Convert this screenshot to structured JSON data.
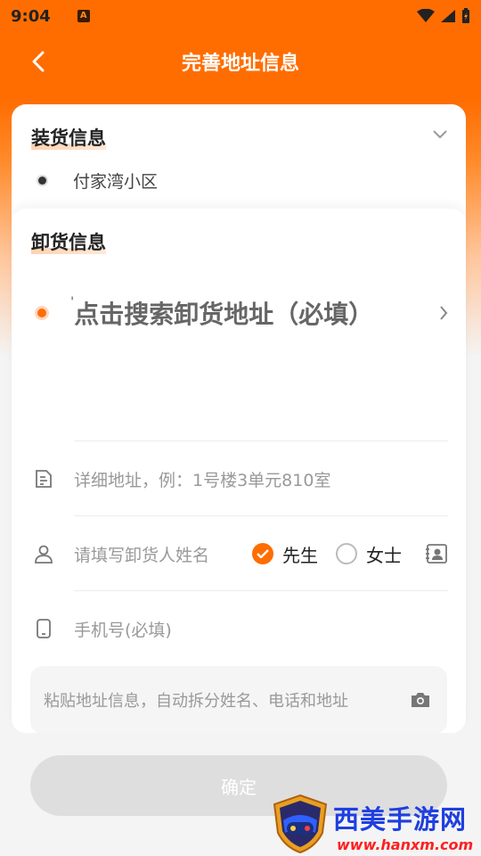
{
  "status_bar": {
    "time": "9:04",
    "app_icon_letter": "A"
  },
  "header": {
    "title": "完善地址信息"
  },
  "load_section": {
    "title": "装货信息",
    "address": "付家湾小区"
  },
  "unload_section": {
    "title": "卸货信息",
    "search_placeholder": "点击搜索卸货地址（必填）",
    "search_prefix": "'",
    "detail_placeholder": "详细地址，例：1号楼3单元810室",
    "name_placeholder": "请填写卸货人姓名",
    "gender_options": [
      {
        "label": "先生",
        "selected": true
      },
      {
        "label": "女士",
        "selected": false
      }
    ],
    "phone_placeholder": "手机号(必填)",
    "paste_placeholder": "粘贴地址信息，自动拆分姓名、电话和地址",
    "confirm_label": "确定"
  },
  "watermark": {
    "title": "西美手游网",
    "url": "www.hanxm.com"
  },
  "colors": {
    "accent": "#ff6d00",
    "button_disabled": "#dedede",
    "watermark_blue": "#1f3fe0",
    "watermark_red": "#ff2020"
  }
}
